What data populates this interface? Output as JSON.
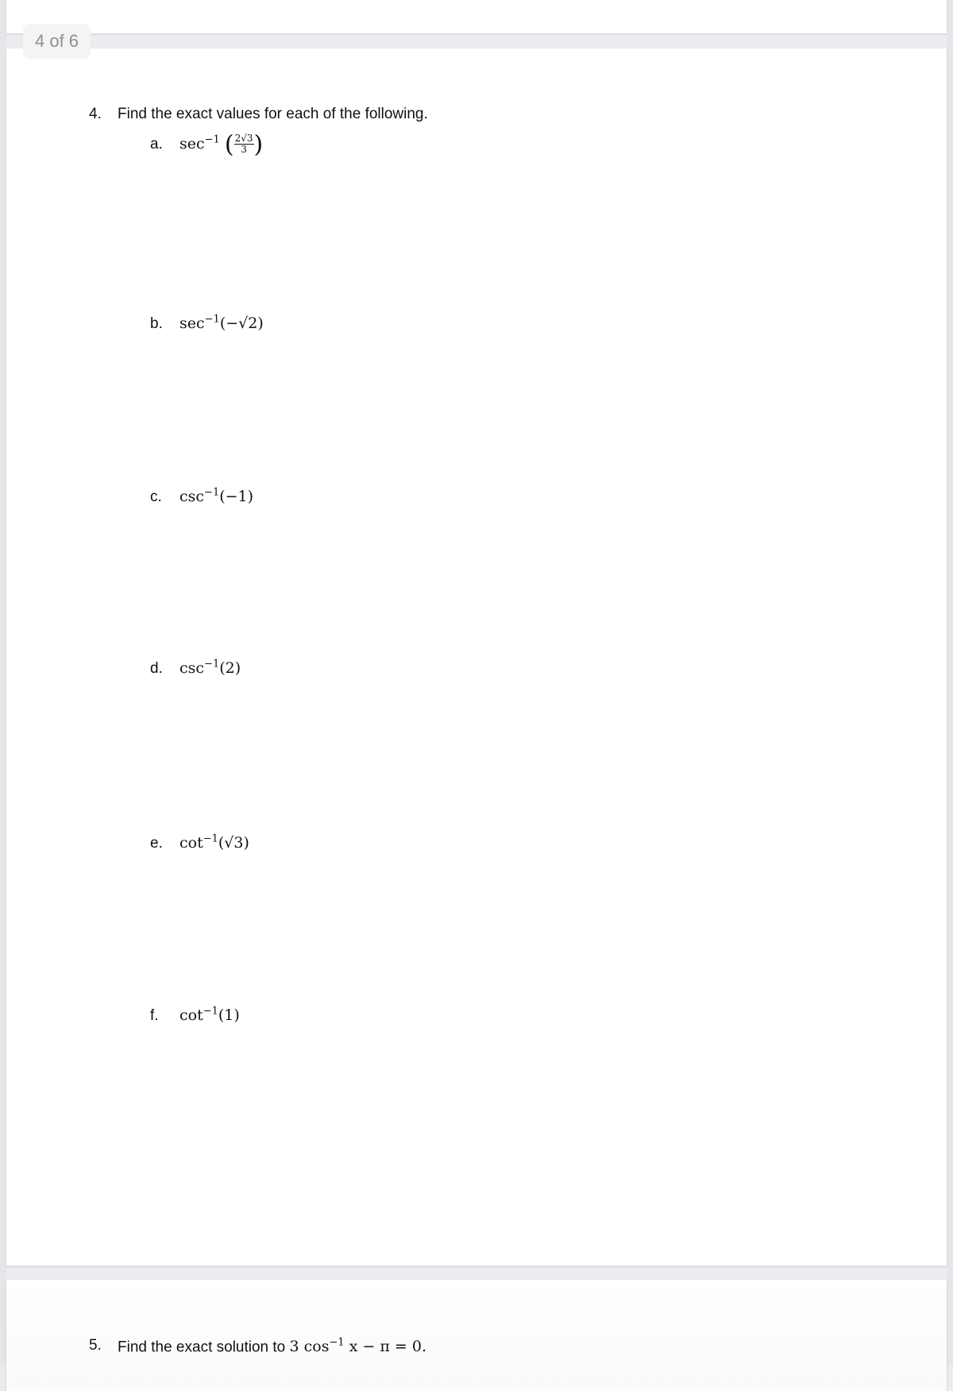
{
  "page_indicator": "4 of 6",
  "question4": {
    "number": "4.",
    "prompt": "Find the exact values for each of the following.",
    "items": [
      {
        "label": "a.",
        "func": "sec",
        "sup": "−1",
        "frac_num": "2√3",
        "frac_den": "3"
      },
      {
        "label": "b.",
        "func": "sec",
        "sup": "−1",
        "arg": "(−√2)"
      },
      {
        "label": "c.",
        "func": "csc",
        "sup": "−1",
        "arg": "(−1)"
      },
      {
        "label": "d.",
        "func": "csc",
        "sup": "−1",
        "arg": "(2)"
      },
      {
        "label": "e.",
        "func": "cot",
        "sup": "−1",
        "arg": "(√3)"
      },
      {
        "label": "f.",
        "func": "cot",
        "sup": "−1",
        "arg": "(1)"
      }
    ]
  },
  "question5": {
    "number": "5.",
    "prompt_text": "Find the exact solution to ",
    "eq_coef": "3 cos",
    "eq_sup": "−1",
    "eq_rest": " x − π = 0."
  }
}
